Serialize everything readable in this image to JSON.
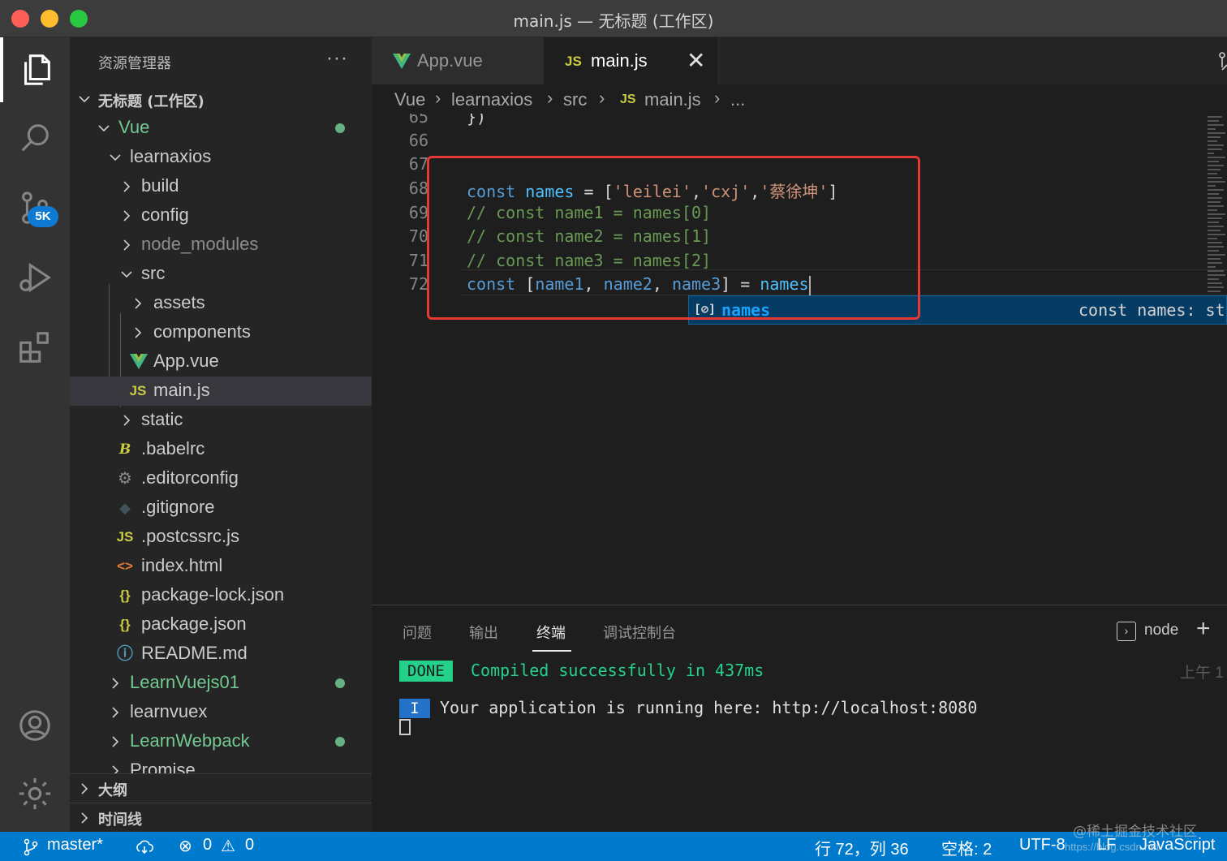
{
  "window": {
    "title": "main.js — 无标题 (工作区)"
  },
  "activity_bar": {
    "items": [
      "files-icon",
      "search-icon",
      "source-control-icon",
      "run-debug-icon",
      "extensions-icon"
    ],
    "source_control_badge": "5K",
    "bottom": [
      "account-icon",
      "settings-gear-icon"
    ]
  },
  "sidebar": {
    "title": "资源管理器",
    "more": "···",
    "workspace": "无标题 (工作区)",
    "tree": [
      {
        "label": "Vue",
        "kind": "folder-open",
        "modified": true
      },
      {
        "label": "learnaxios",
        "kind": "folder-open"
      },
      {
        "label": "build",
        "kind": "folder"
      },
      {
        "label": "config",
        "kind": "folder"
      },
      {
        "label": "node_modules",
        "kind": "folder"
      },
      {
        "label": "src",
        "kind": "folder-open"
      },
      {
        "label": "assets",
        "kind": "folder"
      },
      {
        "label": "components",
        "kind": "folder"
      },
      {
        "label": "App.vue",
        "kind": "vue"
      },
      {
        "label": "main.js",
        "kind": "js",
        "selected": true
      },
      {
        "label": "static",
        "kind": "folder"
      },
      {
        "label": ".babelrc",
        "kind": "babel"
      },
      {
        "label": ".editorconfig",
        "kind": "gear"
      },
      {
        "label": ".gitignore",
        "kind": "git"
      },
      {
        "label": ".postcssrc.js",
        "kind": "js"
      },
      {
        "label": "index.html",
        "kind": "html"
      },
      {
        "label": "package-lock.json",
        "kind": "json"
      },
      {
        "label": "package.json",
        "kind": "json"
      },
      {
        "label": "README.md",
        "kind": "info"
      },
      {
        "label": "LearnVuejs01",
        "kind": "folder",
        "modified": true
      },
      {
        "label": "learnvuex",
        "kind": "folder"
      },
      {
        "label": "LearnWebpack",
        "kind": "folder",
        "modified": true
      },
      {
        "label": "Promise",
        "kind": "folder"
      }
    ],
    "sections": [
      "大纲",
      "时间线"
    ]
  },
  "tabs": [
    {
      "label": "App.vue",
      "icon": "vue-icon",
      "active": false
    },
    {
      "label": "main.js",
      "icon": "js-icon",
      "active": true,
      "close": "✕"
    }
  ],
  "breadcrumb": [
    "Vue",
    "learnaxios",
    "src",
    "main.js",
    "..."
  ],
  "editor": {
    "lines": [
      {
        "num": "65",
        "text": "})"
      },
      {
        "num": "66",
        "text": ""
      },
      {
        "num": "67",
        "text": ""
      },
      {
        "num": "68",
        "text": "const names = ['leilei','cxj','蔡徐坤']"
      },
      {
        "num": "69",
        "text": "// const name1 = names[0]"
      },
      {
        "num": "70",
        "text": "// const name2 = names[1]"
      },
      {
        "num": "71",
        "text": "// const name3 = names[2]"
      },
      {
        "num": "72",
        "text": "const [name1, name2, name3] = names"
      }
    ],
    "suggestion": {
      "icon": "[⊘]",
      "label": "names",
      "detail": "const names: st"
    }
  },
  "panel": {
    "tabs": [
      "问题",
      "输出",
      "终端",
      "调试控制台"
    ],
    "active_tab": "终端",
    "terminal_name": "node",
    "add": "+",
    "done_badge": "DONE",
    "done_text": "Compiled successfully in 437ms",
    "time": "上午 1",
    "info_badge": "I",
    "info_text": "Your application is running here: http://localhost:8080"
  },
  "status_bar": {
    "branch": "master*",
    "errors": "0",
    "warnings": "0",
    "position": "行 72，列 36",
    "spaces": "空格: 2",
    "encoding": "UTF-8",
    "eol": "LF",
    "language": "JavaScript"
  },
  "watermark": {
    "main": "@稀土掘金技术社区",
    "sub": "https://blog.csdn.net"
  }
}
